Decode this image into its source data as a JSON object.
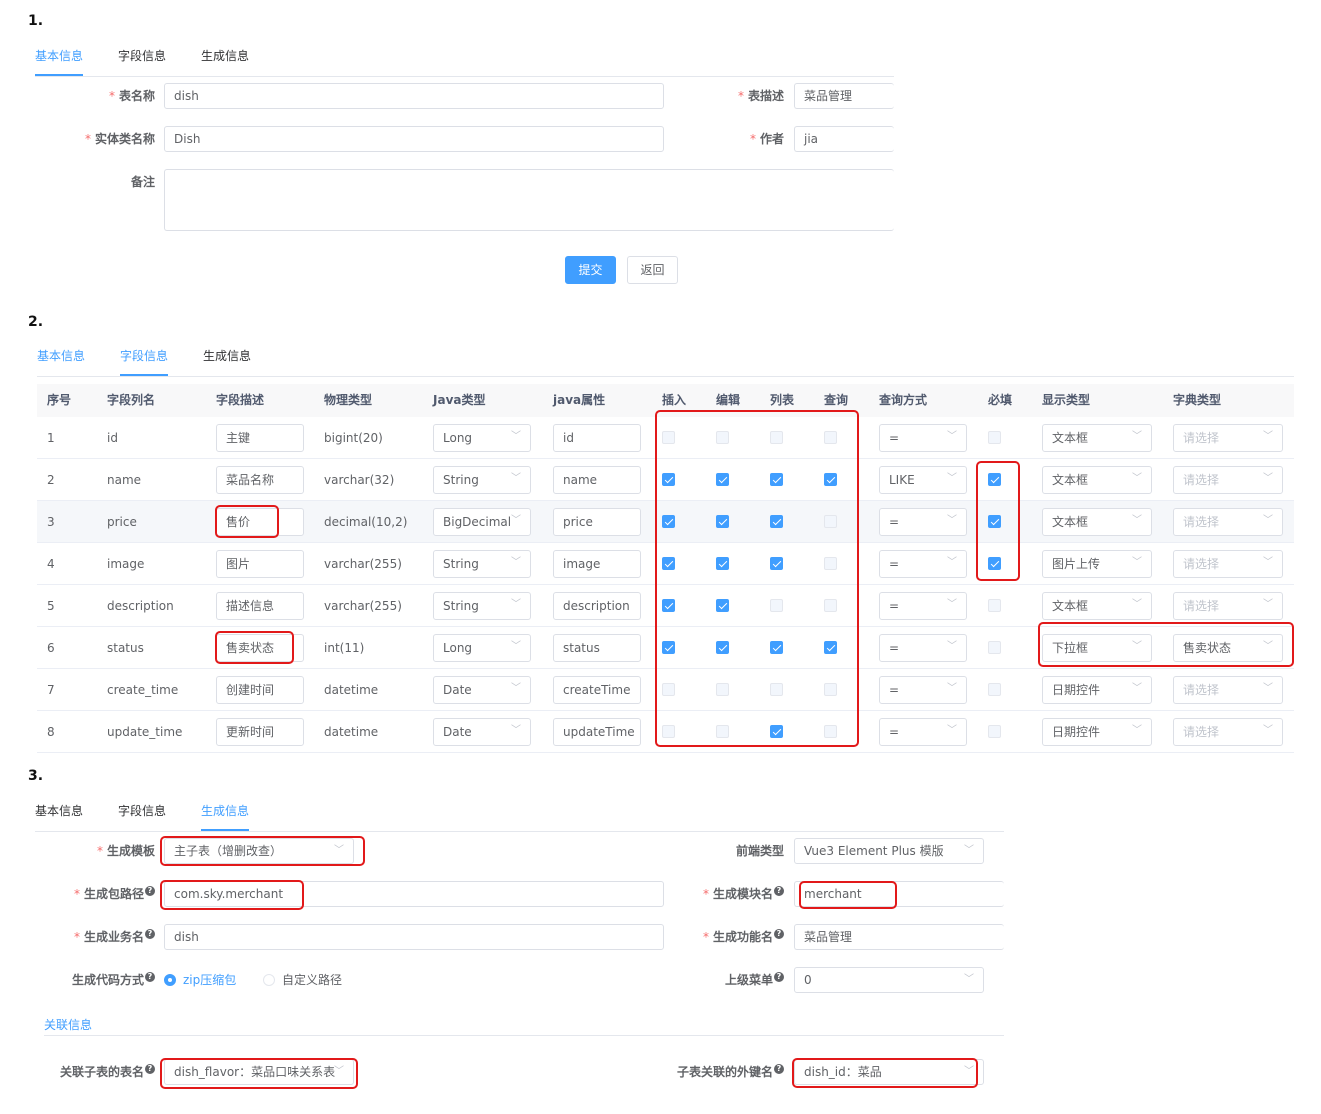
{
  "steps": [
    "1.",
    "2.",
    "3."
  ],
  "tabs": [
    "基本信息",
    "字段信息",
    "生成信息"
  ],
  "basic": {
    "table_name_label": "表名称",
    "table_name": "dish",
    "table_desc_label": "表描述",
    "table_desc": "菜品管理",
    "class_name_label": "实体类名称",
    "class_name": "Dish",
    "author_label": "作者",
    "author": "jia",
    "remark_label": "备注",
    "remark": "",
    "submit": "提交",
    "back": "返回"
  },
  "columns_table": {
    "headers": [
      "序号",
      "字段列名",
      "字段描述",
      "物理类型",
      "Java类型",
      "java属性",
      "插入",
      "编辑",
      "列表",
      "查询",
      "查询方式",
      "必填",
      "显示类型",
      "字典类型"
    ],
    "dict_placeholder": "请选择",
    "rows": [
      {
        "no": "1",
        "column": "id",
        "desc": "主键",
        "phys": "bigint(20)",
        "java_type": "Long",
        "java_field": "id",
        "insert": false,
        "edit": false,
        "list": false,
        "query": false,
        "disabled": true,
        "query_type": "=",
        "required": false,
        "required_disabled": true,
        "html_type": "文本框",
        "dict": ""
      },
      {
        "no": "2",
        "column": "name",
        "desc": "菜品名称",
        "phys": "varchar(32)",
        "java_type": "String",
        "java_field": "name",
        "insert": true,
        "edit": true,
        "list": true,
        "query": true,
        "disabled": false,
        "query_type": "LIKE",
        "required": true,
        "required_disabled": false,
        "html_type": "文本框",
        "dict": ""
      },
      {
        "no": "3",
        "column": "price",
        "desc": "售价",
        "phys": "decimal(10,2)",
        "java_type": "BigDecimal",
        "java_field": "price",
        "insert": true,
        "edit": true,
        "list": true,
        "query": false,
        "disabled": false,
        "query_type": "=",
        "required": true,
        "required_disabled": false,
        "html_type": "文本框",
        "dict": ""
      },
      {
        "no": "4",
        "column": "image",
        "desc": "图片",
        "phys": "varchar(255)",
        "java_type": "String",
        "java_field": "image",
        "insert": true,
        "edit": true,
        "list": true,
        "query": false,
        "disabled": false,
        "query_type": "=",
        "required": true,
        "required_disabled": false,
        "html_type": "图片上传",
        "dict": ""
      },
      {
        "no": "5",
        "column": "description",
        "desc": "描述信息",
        "phys": "varchar(255)",
        "java_type": "String",
        "java_field": "description",
        "insert": true,
        "edit": true,
        "list": false,
        "query": false,
        "disabled": false,
        "query_type": "=",
        "required": false,
        "required_disabled": true,
        "html_type": "文本框",
        "dict": ""
      },
      {
        "no": "6",
        "column": "status",
        "desc": "售卖状态",
        "phys": "int(11)",
        "java_type": "Long",
        "java_field": "status",
        "insert": true,
        "edit": true,
        "list": true,
        "query": true,
        "disabled": false,
        "query_type": "=",
        "required": false,
        "required_disabled": true,
        "html_type": "下拉框",
        "dict": "售卖状态"
      },
      {
        "no": "7",
        "column": "create_time",
        "desc": "创建时间",
        "phys": "datetime",
        "java_type": "Date",
        "java_field": "createTime",
        "insert": false,
        "edit": false,
        "list": false,
        "query": false,
        "disabled": false,
        "query_type": "=",
        "required": false,
        "required_disabled": true,
        "html_type": "日期控件",
        "dict": ""
      },
      {
        "no": "8",
        "column": "update_time",
        "desc": "更新时间",
        "phys": "datetime",
        "java_type": "Date",
        "java_field": "updateTime",
        "insert": false,
        "edit": false,
        "list": true,
        "query": false,
        "disabled": false,
        "query_type": "=",
        "required": false,
        "required_disabled": true,
        "html_type": "日期控件",
        "dict": ""
      }
    ]
  },
  "gen": {
    "tpl_label": "生成模板",
    "tpl_value": "主子表（增删改查）",
    "frontend_label": "前端类型",
    "frontend_value": "Vue3 Element Plus 模版",
    "package_label": "生成包路径",
    "package_value": "com.sky.merchant",
    "module_label": "生成模块名",
    "module_value": "merchant",
    "business_label": "生成业务名",
    "business_value": "dish",
    "function_label": "生成功能名",
    "function_value": "菜品管理",
    "gen_type_label": "生成代码方式",
    "gen_type_zip": "zip压缩包",
    "gen_type_path": "自定义路径",
    "parent_menu_label": "上级菜单",
    "parent_menu_value": "0",
    "related_title": "关联信息",
    "sub_table_label": "关联子表的表名",
    "sub_table_value": "dish_flavor：菜品口味关系表",
    "fk_label": "子表关联的外键名",
    "fk_value": "dish_id：菜品"
  },
  "colors": {
    "accent": "#409eff",
    "highlight": "#e2191a",
    "required_star": "#f56c6c"
  }
}
